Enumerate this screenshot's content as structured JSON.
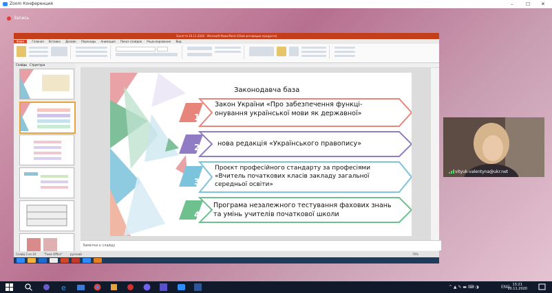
{
  "zoom": {
    "window_title": "Zoom Конференция",
    "record_label": "Запись",
    "minimize": "–",
    "maximize": "☐",
    "close": "✕"
  },
  "powerpoint": {
    "title": "Заняття 10.11.2020 - Microsoft PowerPoint (Сбой активации продукта)",
    "tabs": [
      "Файл",
      "Главная",
      "Вставка",
      "Дизайн",
      "Переходы",
      "Анимация",
      "Показ слайдов",
      "Рецензирование",
      "Вид"
    ],
    "thumb_tabs": [
      "Слайды",
      "Структура"
    ],
    "notes_placeholder": "Заметки к слайду",
    "status_left": "Слайд 2 из 24",
    "status_mid": "\"Тема Office\"",
    "status_lang": "русский",
    "zoom_level": "70%"
  },
  "slide": {
    "title": "Законодавча база",
    "items": [
      {
        "num": "1",
        "text": "Закон України «Про забезпечення функці-онування української мови як державної»"
      },
      {
        "num": "2",
        "text": "нова редакція «Українського правопису»"
      },
      {
        "num": "3",
        "text": "Проєкт професійного стандарту за професіями «Вчитель початкових класів закладу загальної середньої освіти»"
      },
      {
        "num": "4",
        "text": "Програма незалежного тестування фахових знань та умінь учителів початкової школи"
      }
    ],
    "colors": {
      "item1": "#e8857a",
      "item2": "#8f7cc4",
      "item3": "#7cc3dd",
      "item4": "#6ec08c"
    }
  },
  "video": {
    "participant": "vityuk-valentyna@ukr.net"
  },
  "taskbar": {
    "time": "13:21",
    "date": "10.11.2020",
    "lang": "ENG"
  }
}
